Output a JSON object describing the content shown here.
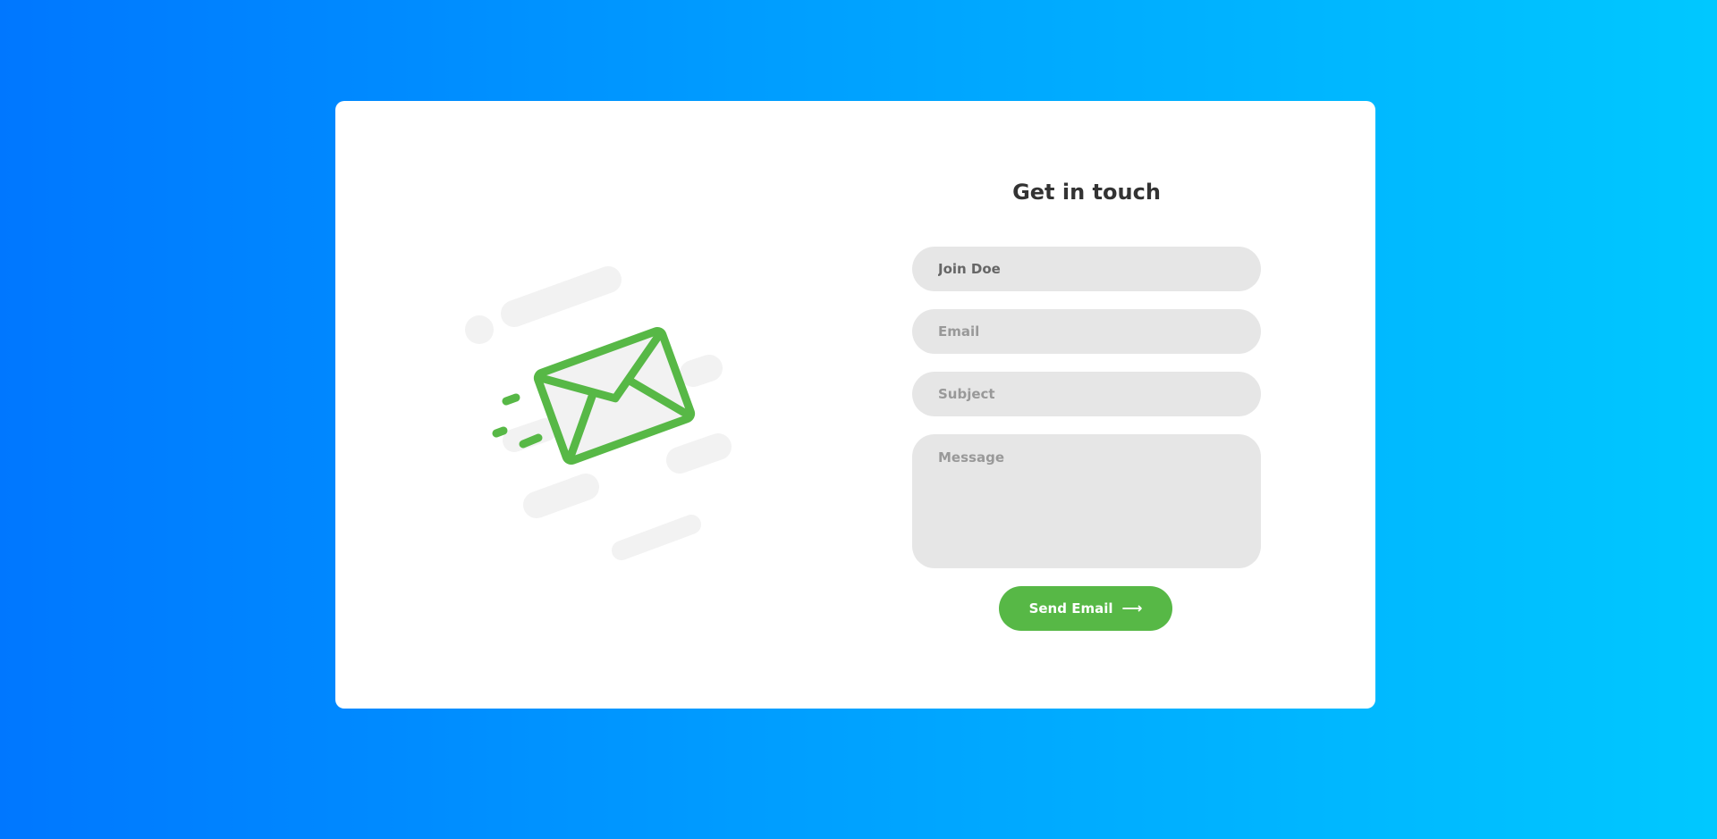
{
  "contact": {
    "title": "Get in touch",
    "name_value": "Join Doe",
    "email_placeholder": "Email",
    "subject_placeholder": "Subject",
    "message_placeholder": "Message",
    "send_label": "Send Email",
    "send_icon": "arrow-right-icon"
  },
  "illustration": {
    "icon": "envelope-icon"
  },
  "colors": {
    "background_start": "#0077ff",
    "background_end": "#00c8ff",
    "card": "#ffffff",
    "accent": "#57b846",
    "field": "#e6e6e6",
    "title": "#333333"
  }
}
